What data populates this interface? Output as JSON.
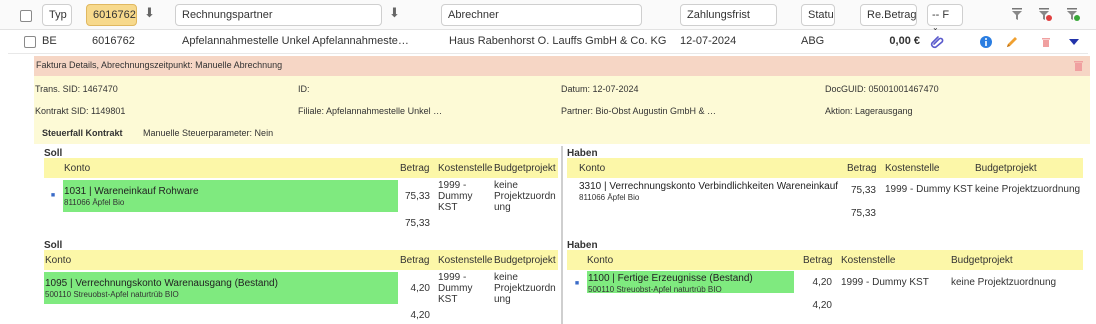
{
  "filters": {
    "typ": "Typ",
    "nummer": "6016762",
    "rechnungspartner": "Rechnungspartner",
    "abrechner": "Abrechner",
    "zahlungsfrist": "Zahlungsfrist",
    "status": "Status",
    "rebetrag": "Re.Betrag",
    "filter_select": "-- F"
  },
  "row": {
    "typ": "BE",
    "nummer": "6016762",
    "partner": "Apfelannahmestelle Unkel Apfelannahmeste…",
    "abrechner": "Haus Rabenhorst O. Lauffs GmbH & Co. KG",
    "datum": "12-07-2024",
    "status": "ABG",
    "betrag": "0,00 €"
  },
  "faktura": {
    "title": "Faktura Details, Abrechnungszeitpunkt: Manuelle Abrechnung",
    "trans_sid": "Trans. SID: 1467470",
    "id": "ID:",
    "datum": "Datum: 12-07-2024",
    "docguid": "DocGUID: 05001001467470",
    "kontrakt_sid": "Kontrakt SID: 1149801",
    "filiale": "Filiale: Apfelannahmestelle Unkel …",
    "partner": "Partner: Bio-Obst Augustin GmbH & …",
    "aktion": "Aktion: Lagerausgang",
    "steuerfall": "Steuerfall Kontrakt",
    "steuerparameter": "Manuelle Steuerparameter: Nein"
  },
  "headers": {
    "konto": "Konto",
    "betrag": "Betrag",
    "kostenstelle": "Kostenstelle",
    "budgetprojekt": "Budgetprojekt",
    "soll": "Soll",
    "haben": "Haben"
  },
  "soll1": {
    "konto": "1031 | Wareneinkauf Rohware",
    "sub": "811066 Äpfel Bio",
    "betrag": "75,33",
    "kst1": "1999 -",
    "kst2": "Dummy",
    "kst3": "KST",
    "bp1": "keine",
    "bp2": "Projektzuordn",
    "bp3": "ung",
    "total": "75,33"
  },
  "haben1": {
    "konto": "3310 | Verrechnungskonto Verbindlichkeiten Wareneinkauf",
    "sub": "811066 Äpfel Bio",
    "betrag": "75,33",
    "kst": "1999 - Dummy KST",
    "bp": "keine Projektzuordnung",
    "total": "75,33"
  },
  "soll2": {
    "konto": "1095 | Verrechnungskonto Warenausgang (Bestand)",
    "sub": "500110 Streuobst-Apfel naturtrüb BIO",
    "betrag": "4,20",
    "kst1": "1999 -",
    "kst2": "Dummy",
    "kst3": "KST",
    "bp1": "keine",
    "bp2": "Projektzuordn",
    "bp3": "ung",
    "total": "4,20"
  },
  "haben2": {
    "konto": "1100 | Fertige Erzeugnisse (Bestand)",
    "sub": "500110 Streuobst-Apfel naturtrüb BIO",
    "betrag": "4,20",
    "kst": "1999 - Dummy KST",
    "bp": "keine Projektzuordnung",
    "total": "4,20"
  },
  "icons": [
    "arrow-down-icon",
    "filter-icon",
    "filter-remove-icon",
    "filter-add-icon",
    "paperclip-icon",
    "info-icon",
    "pencil-icon",
    "trash-icon",
    "expand-triangle-icon",
    "tag-icon"
  ],
  "colors": {
    "selected_filter": "#f7d98c",
    "faktura_bar": "#f6d6c5",
    "details_bg": "#fdfad6",
    "table_header": "#fcf7a8",
    "account_green": "#7fea7f",
    "info_blue": "#2a7de1",
    "pencil_orange": "#f0a030",
    "trash_red": "#f0a0a0",
    "triangle_blue": "#2233aa"
  }
}
